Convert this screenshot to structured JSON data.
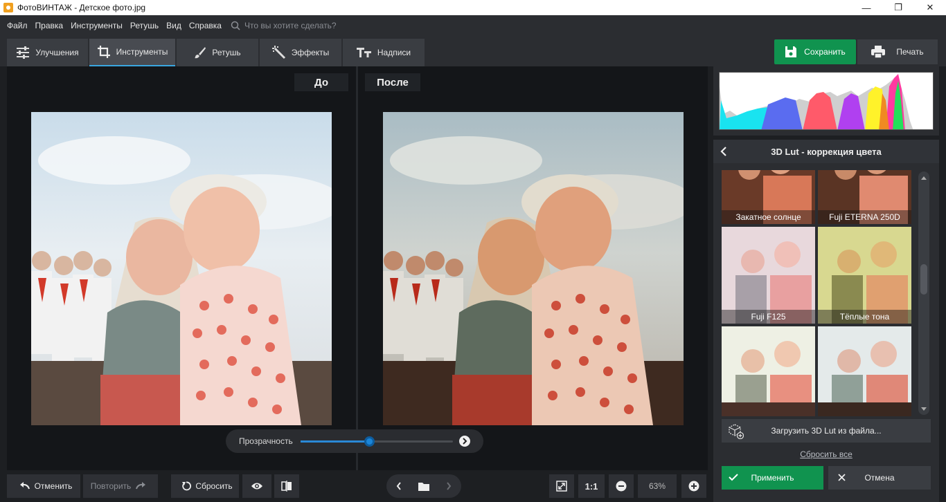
{
  "window": {
    "title": "ФотоВИНТАЖ - Детское фото.jpg",
    "minimize": "—",
    "maximize": "❐",
    "close": "✕"
  },
  "menu": {
    "items": [
      "Файл",
      "Правка",
      "Инструменты",
      "Ретушь",
      "Вид",
      "Справка"
    ],
    "search_placeholder": "Что вы хотите сделать?"
  },
  "tabs": [
    {
      "label": "Улучшения",
      "icon": "sliders-icon",
      "active": false
    },
    {
      "label": "Инструменты",
      "icon": "crop-icon",
      "active": true
    },
    {
      "label": "Ретушь",
      "icon": "brush-icon",
      "active": false
    },
    {
      "label": "Эффекты",
      "icon": "magic-wand-icon",
      "active": false
    },
    {
      "label": "Надписи",
      "icon": "text-icon",
      "active": false
    }
  ],
  "toolbar": {
    "save_label": "Сохранить",
    "print_label": "Печать"
  },
  "compare": {
    "before_label": "До",
    "after_label": "После"
  },
  "opacity": {
    "label": "Прозрачность",
    "value": 0.45
  },
  "panel": {
    "title": "3D Lut - коррекция цвета",
    "presets": [
      {
        "name": "Закатное солнце"
      },
      {
        "name": "Fuji ETERNA 250D"
      },
      {
        "name": "Fuji F125"
      },
      {
        "name": "Тёплые тона"
      },
      {
        "name": ""
      },
      {
        "name": ""
      }
    ],
    "load_label": "Загрузить 3D Lut из файла...",
    "reset_all_label": "Сбросить все",
    "apply_label": "Применить",
    "cancel_label": "Отмена"
  },
  "bottom": {
    "undo_label": "Отменить",
    "redo_label": "Повторить",
    "reset_label": "Сбросить",
    "one_to_one": "1:1",
    "zoom": "63%"
  },
  "colors": {
    "accent_green": "#10934f",
    "accent_blue": "#2a89d6"
  }
}
